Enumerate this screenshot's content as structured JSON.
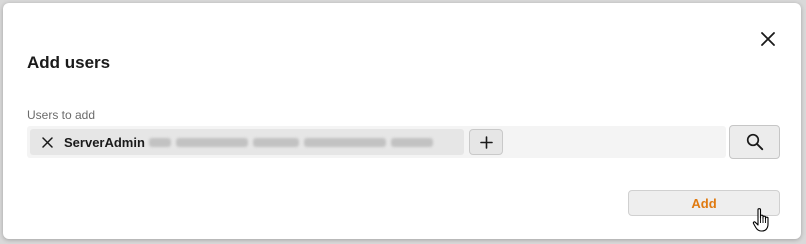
{
  "dialog": {
    "title": "Add users",
    "close_icon": "close-icon"
  },
  "field": {
    "label": "Users to add",
    "chip": {
      "name": "ServerAdmin",
      "remove_icon": "close-icon",
      "details_redacted": true
    },
    "add_more_icon": "plus-icon"
  },
  "search_button": {
    "icon": "search-icon"
  },
  "footer": {
    "add_label": "Add"
  },
  "colors": {
    "accent": "#e07a10",
    "dialog_bg": "#ffffff",
    "backdrop": "#d9d9d9"
  }
}
